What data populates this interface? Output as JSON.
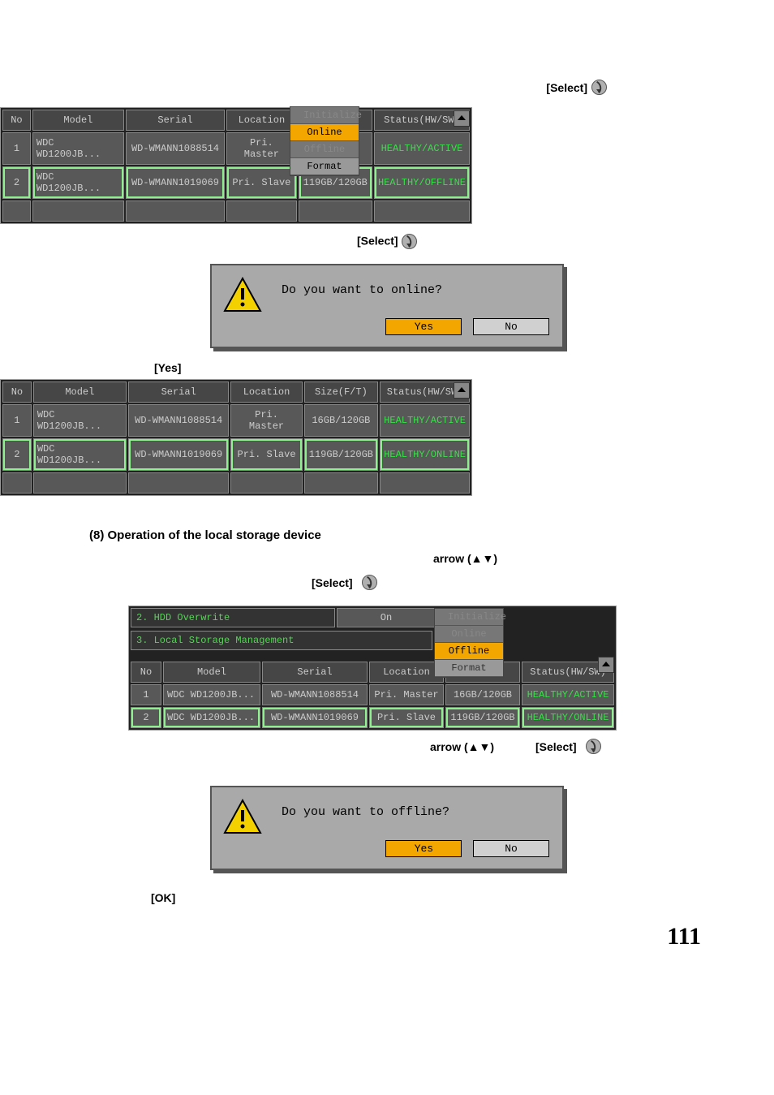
{
  "labels": {
    "select": "[Select]",
    "yes_label": "[Yes]",
    "ok_label": "[OK]",
    "arrow": "arrow (▲▼)"
  },
  "section8": "(8) Operation of the local storage device",
  "page_number": "111",
  "table_headers": {
    "no": "No",
    "model": "Model",
    "serial": "Serial",
    "location": "Location",
    "size": "Size(F/T)",
    "status": "Status(HW/SW)"
  },
  "popup_a": {
    "items": [
      "Initialize",
      "Online",
      "Offline",
      "Format"
    ],
    "selected": 1
  },
  "popup_b": {
    "items": [
      "Initialize",
      "Online",
      "Offline",
      "Format"
    ],
    "selected": 2
  },
  "table1": {
    "rows": [
      {
        "no": "1",
        "model": "WDC WD1200JB...",
        "serial": "WD-WMANN1088514",
        "location": "Pri. Master",
        "size": "",
        "status": "HEALTHY/ACTIVE"
      },
      {
        "no": "2",
        "model": "WDC WD1200JB...",
        "serial": "WD-WMANN1019069",
        "location": "Pri. Slave",
        "size": "119GB/120GB",
        "status": "HEALTHY/OFFLINE"
      }
    ],
    "selected_row": 1
  },
  "table2": {
    "rows": [
      {
        "no": "1",
        "model": "WDC WD1200JB...",
        "serial": "WD-WMANN1088514",
        "location": "Pri. Master",
        "size": "16GB/120GB",
        "status": "HEALTHY/ACTIVE"
      },
      {
        "no": "2",
        "model": "WDC WD1200JB...",
        "serial": "WD-WMANN1019069",
        "location": "Pri. Slave",
        "size": "119GB/120GB",
        "status": "HEALTHY/ONLINE"
      }
    ],
    "selected_row": 1
  },
  "cfg": {
    "row1_label": "2. HDD Overwrite",
    "row1_value": "On",
    "row2_label": "3. Local Storage Management"
  },
  "table3": {
    "rows": [
      {
        "no": "1",
        "model": "WDC WD1200JB...",
        "serial": "WD-WMANN1088514",
        "location": "Pri. Master",
        "size": "16GB/120GB",
        "status": "HEALTHY/ACTIVE"
      },
      {
        "no": "2",
        "model": "WDC WD1200JB...",
        "serial": "WD-WMANN1019069",
        "location": "Pri. Slave",
        "size": "119GB/120GB",
        "status": "HEALTHY/ONLINE"
      }
    ],
    "selected_row": 1
  },
  "confirm1": {
    "message": "Do you want to online?",
    "yes": "Yes",
    "no": "No"
  },
  "confirm2": {
    "message": "Do you want to offline?",
    "yes": "Yes",
    "no": "No"
  }
}
